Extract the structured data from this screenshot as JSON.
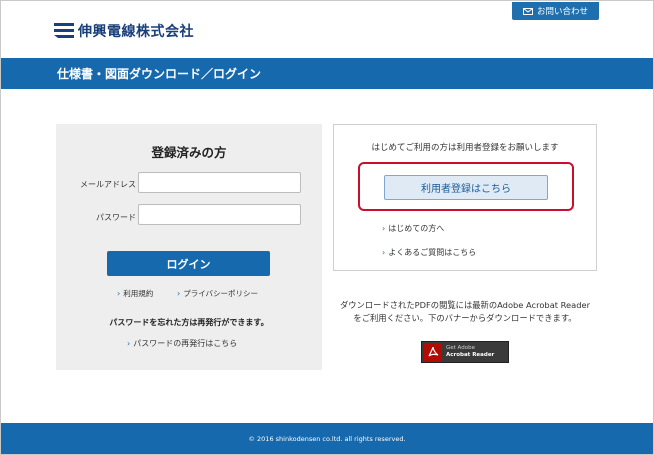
{
  "header": {
    "logo_text": "伸興電線株式会社",
    "contact_label": "お問い合わせ"
  },
  "title_bar": {
    "title": "仕様書・図面ダウンロード／ログイン"
  },
  "login": {
    "heading": "登録済みの方",
    "email_label": "メールアドレス",
    "email_value": "",
    "password_label": "パスワード",
    "password_value": "",
    "login_button": "ログイン",
    "terms_link": "利用規約",
    "privacy_link": "プライバシーポリシー",
    "forgot_text": "パスワードを忘れた方は再発行ができます。",
    "reissue_link": "パスワードの再発行はこちら"
  },
  "register": {
    "intro": "はじめてご利用の方は利用者登録をお願いします",
    "register_button": "利用者登録はこちら",
    "first_time_link": "はじめての方へ",
    "faq_link": "よくあるご質問はこちら"
  },
  "download_note": {
    "line1": "ダウンロードされたPDFの閲覧には最新のAdobe Acrobat Reader",
    "line2": "をご利用ください。下のバナーからダウンロードできます。"
  },
  "adobe_badge": {
    "line1": "Get Adobe",
    "line2": "Acrobat Reader"
  },
  "footer": {
    "copyright": "© 2016 shinkodensen co.ltd. all rights reserved."
  },
  "colors": {
    "brand_blue": "#1669ad",
    "highlight_red": "#c8102e",
    "panel_gray": "#eeeeee"
  }
}
